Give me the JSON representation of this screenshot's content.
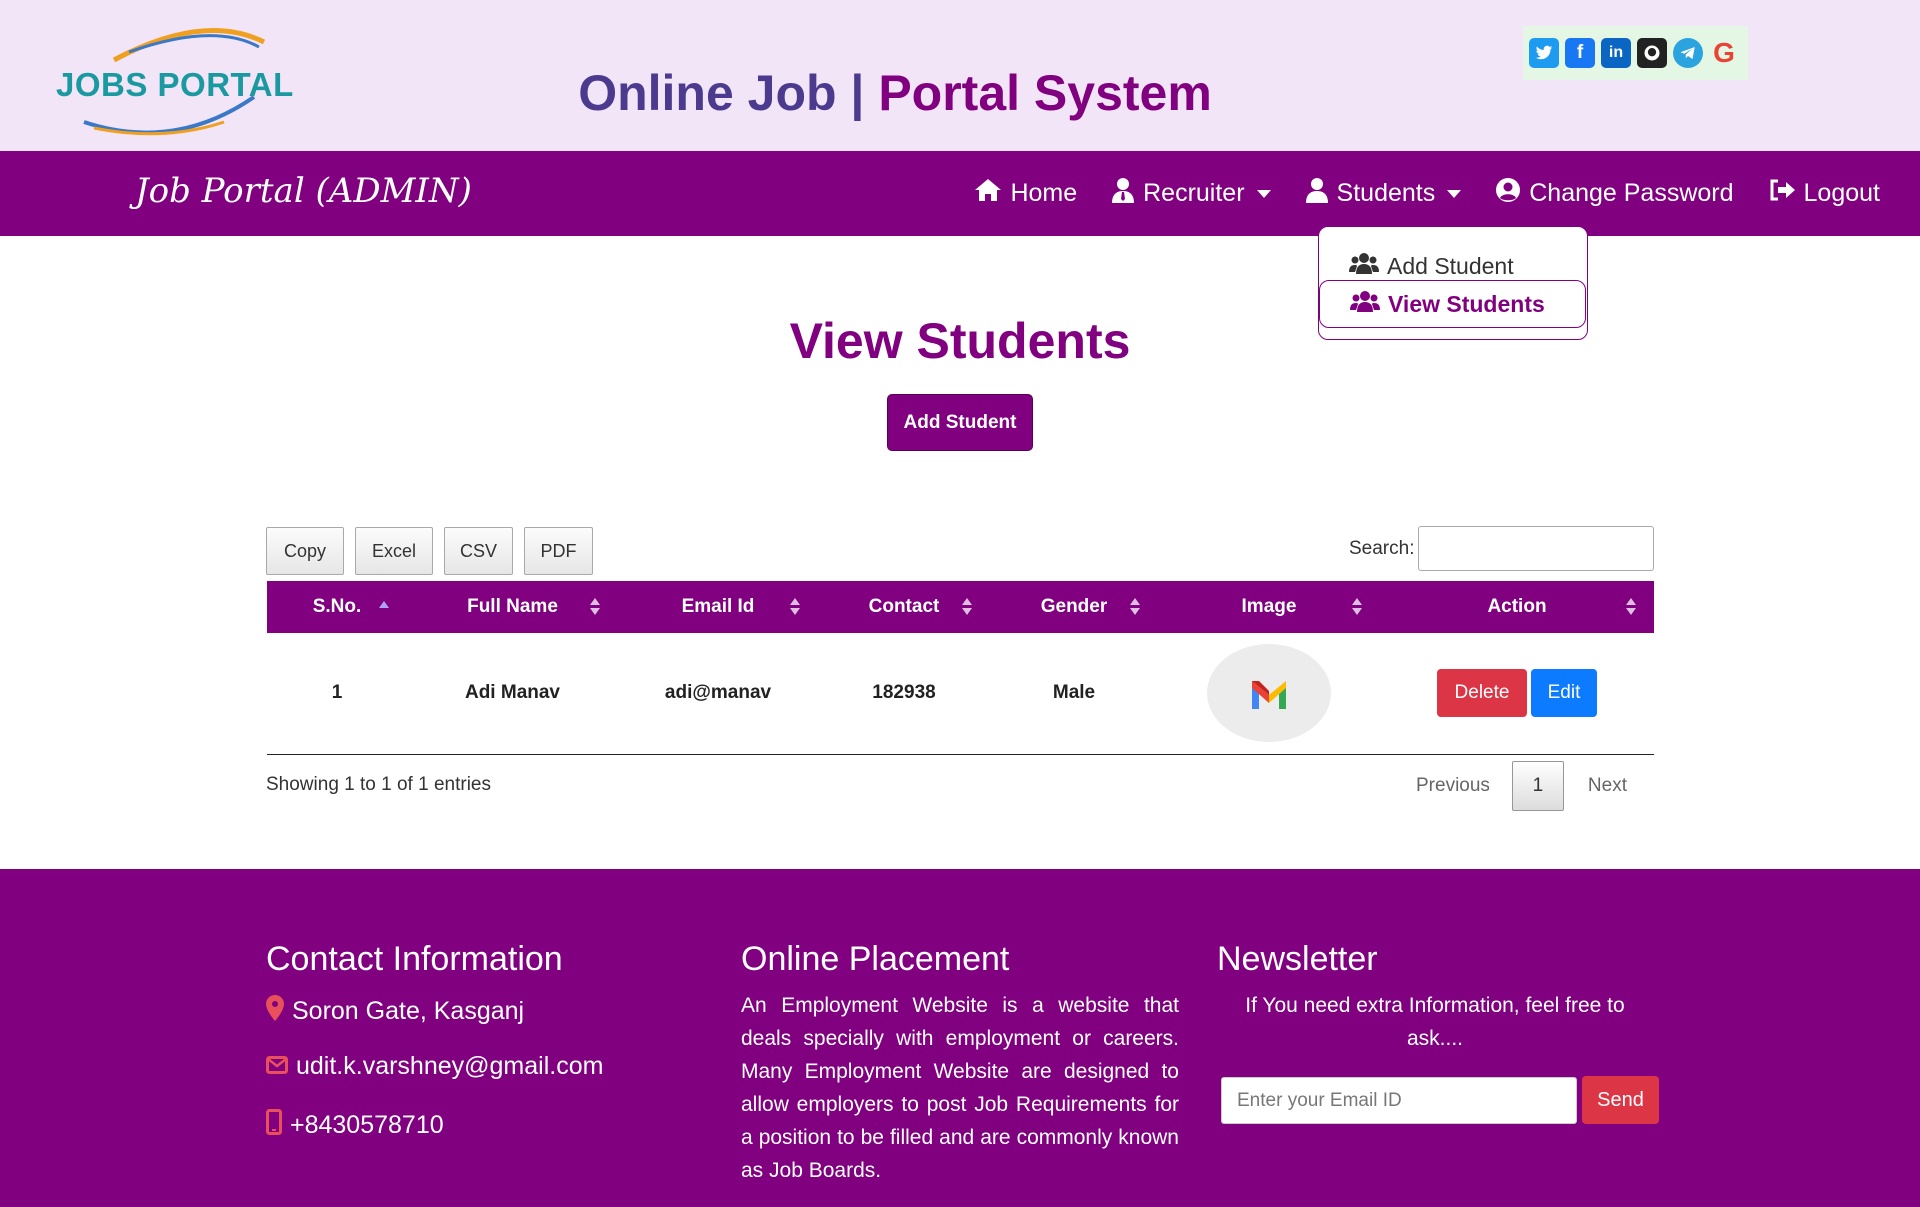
{
  "header": {
    "logo_text": "JOBS PORTAL",
    "title_part1": "Online Job |",
    "title_part2": "Portal System",
    "social_icons": [
      "twitter-icon",
      "facebook-icon",
      "linkedin-icon",
      "github-icon",
      "telegram-icon",
      "google-icon"
    ]
  },
  "navbar": {
    "brand": "Job Portal (ADMIN)",
    "links": {
      "home": "Home",
      "recruiter": "Recruiter",
      "students": "Students",
      "change_password": "Change Password",
      "logout": "Logout"
    },
    "students_dropdown": {
      "add_student": "Add Student",
      "view_students": "View Students"
    }
  },
  "main": {
    "heading": "View Students",
    "add_button": "Add Student",
    "export_buttons": {
      "copy": "Copy",
      "excel": "Excel",
      "csv": "CSV",
      "pdf": "PDF"
    },
    "search_label": "Search:",
    "table": {
      "columns": [
        "S.No.",
        "Full Name",
        "Email Id",
        "Contact",
        "Gender",
        "Image",
        "Action"
      ],
      "rows": [
        {
          "sno": "1",
          "full_name": "Adi Manav",
          "email": "adi@manav",
          "contact": "182938",
          "gender": "Male",
          "image": "gmail-icon"
        }
      ],
      "row_actions": {
        "delete": "Delete",
        "edit": "Edit"
      }
    },
    "info": "Showing 1 to 1 of 1 entries",
    "pagination": {
      "previous": "Previous",
      "current": "1",
      "next": "Next"
    }
  },
  "footer": {
    "contact": {
      "heading": "Contact Information",
      "address": "Soron Gate, Kasganj",
      "email": "udit.k.varshney@gmail.com",
      "phone": "+8430578710"
    },
    "placement": {
      "heading": "Online Placement",
      "text": "An Employment Website is a website that deals specially with employment or careers. Many Employment Website are designed to allow employers to post Job Requirements for a position to be filled and are commonly known as Job Boards."
    },
    "newsletter": {
      "heading": "Newsletter",
      "text": "If You need extra Information, feel free to ask....",
      "email_placeholder": "Enter your Email ID",
      "send_label": "Send"
    }
  },
  "colors": {
    "primary": "#800080",
    "banner_bg": "#f3e5f8",
    "danger": "#dc3545",
    "info_blue": "#0d7bff"
  }
}
